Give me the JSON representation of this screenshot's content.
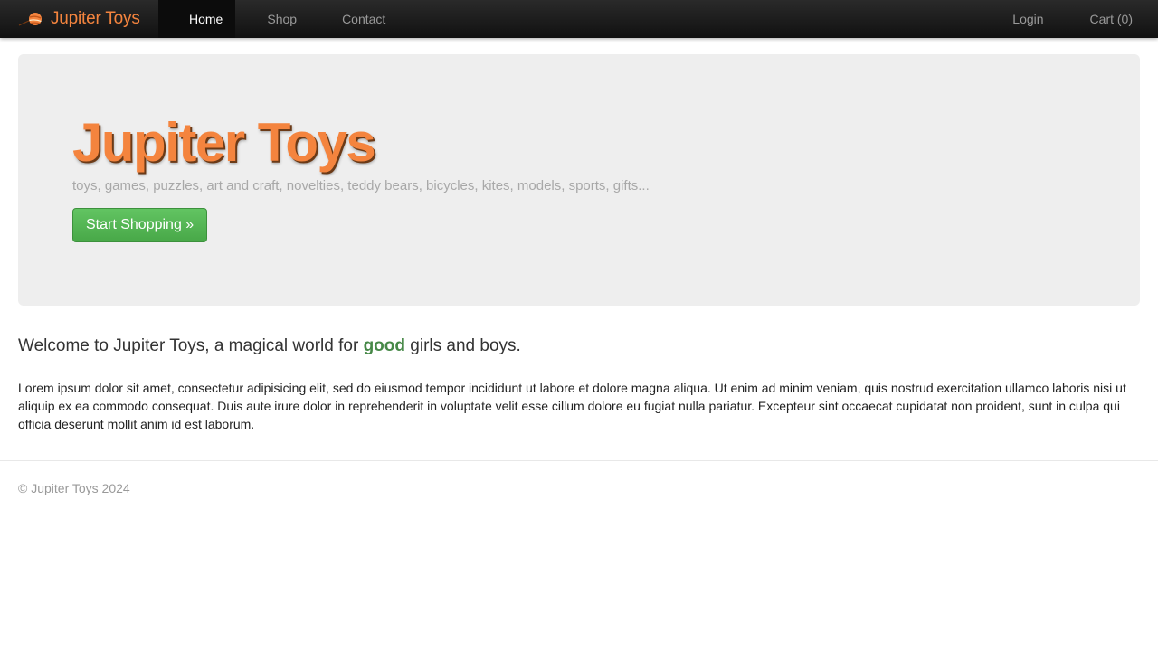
{
  "navbar": {
    "brand": {
      "logo_icon": "planet-icon",
      "text": "Jupiter Toys"
    },
    "left_items": [
      {
        "label": "Home",
        "active": true
      },
      {
        "label": "Shop",
        "active": false
      },
      {
        "label": "Contact",
        "active": false
      }
    ],
    "right_items": [
      {
        "label": "Login"
      },
      {
        "label": "Cart (0)"
      }
    ]
  },
  "hero": {
    "title": "Jupiter Toys",
    "subtitle": "toys, games, puzzles, art and craft, novelties, teddy bears, bicycles, kites, models, sports, gifts...",
    "button_label": "Start Shopping »"
  },
  "welcome": {
    "prefix": "Welcome to Jupiter Toys, a magical world for ",
    "highlight": "good",
    "suffix": " girls and boys."
  },
  "body_text": "Lorem ipsum dolor sit amet, consectetur adipisicing elit, sed do eiusmod tempor incididunt ut labore et dolore magna aliqua. Ut enim ad minim veniam, quis nostrud exercitation ullamco laboris nisi ut aliquip ex ea commodo consequat. Duis aute irure dolor in reprehenderit in voluptate velit esse cillum dolore eu fugiat nulla pariatur. Excepteur sint occaecat cupidatat non proident, sunt in culpa qui officia deserunt mollit anim id est laborum.",
  "footer": {
    "copyright": "© Jupiter Toys 2024"
  },
  "colors": {
    "brand_orange": "#f4843e",
    "navbar_bg": "#1b1b1b",
    "hero_bg": "#eeeeee",
    "button_green": "#51b351",
    "highlight_green": "#468847",
    "muted_text": "#999999"
  }
}
